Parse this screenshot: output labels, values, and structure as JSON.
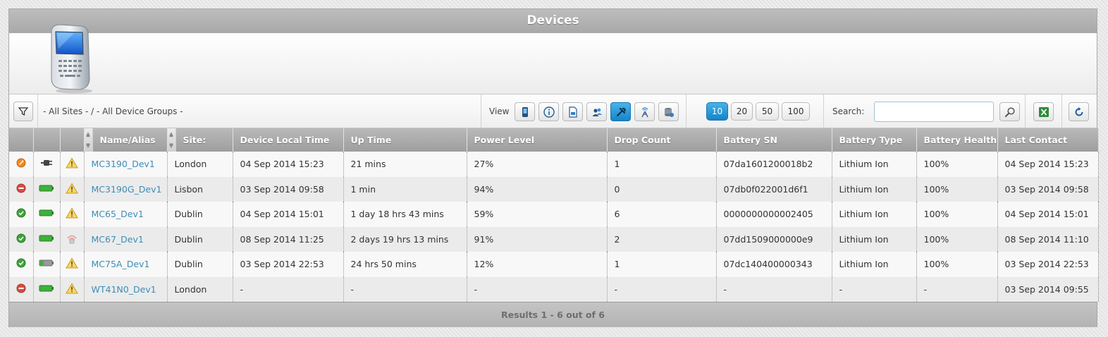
{
  "header": {
    "title": "Devices"
  },
  "toolbar": {
    "filter_path": "- All Sites - / - All Device Groups -",
    "view_label": "View",
    "view_icons": [
      "device-icon",
      "info-icon",
      "document-icon",
      "users-icon",
      "tools-icon",
      "antenna-icon",
      "database-icon"
    ],
    "active_view": "tools-icon",
    "page_sizes": [
      "10",
      "20",
      "50",
      "100"
    ],
    "active_page_size": "10",
    "search_label": "Search:",
    "search_value": "",
    "search_placeholder": ""
  },
  "table": {
    "columns": [
      "Name/Alias",
      "Site:",
      "Device Local Time",
      "Up Time",
      "Power Level",
      "Drop Count",
      "Battery SN",
      "Battery Type",
      "Battery Health",
      "Last Contact"
    ],
    "rows": [
      {
        "status": "warning-orange",
        "power": "plug",
        "alert": "warning",
        "cells": [
          "MC3190_Dev1",
          "London",
          "04 Sep 2014 15:23",
          "21 mins",
          "27%",
          "1",
          "07da1601200018b2",
          "Lithium Ion",
          "100%",
          "04 Sep 2014 15:23"
        ]
      },
      {
        "status": "stop-red",
        "power": "battery",
        "alert": "warning",
        "cells": [
          "MC3190G_Dev1",
          "Lisbon",
          "03 Sep 2014 09:58",
          "1 min",
          "94%",
          "0",
          "07db0f022001d6f1",
          "Lithium Ion",
          "100%",
          "03 Sep 2014 09:58"
        ]
      },
      {
        "status": "ok-green",
        "power": "battery",
        "alert": "warning",
        "cells": [
          "MC65_Dev1",
          "Dublin",
          "04 Sep 2014 15:01",
          "1 day 18 hrs 43 mins",
          "59%",
          "6",
          "0000000000002405",
          "Lithium Ion",
          "100%",
          "04 Sep 2014 15:01"
        ]
      },
      {
        "status": "ok-green",
        "power": "battery",
        "alert": "signal",
        "cells": [
          "MC67_Dev1",
          "Dublin",
          "08 Sep 2014 11:25",
          "2 days 19 hrs 13 mins",
          "91%",
          "2",
          "07dd1509000000e9",
          "Lithium Ion",
          "100%",
          "08 Sep 2014 11:10"
        ]
      },
      {
        "status": "ok-green",
        "power": "battery-low",
        "alert": "warning",
        "cells": [
          "MC75A_Dev1",
          "Dublin",
          "03 Sep 2014 22:53",
          "24 hrs 50 mins",
          "12%",
          "1",
          "07dc140400000343",
          "Lithium Ion",
          "100%",
          "03 Sep 2014 22:53"
        ]
      },
      {
        "status": "stop-red",
        "power": "battery",
        "alert": "warning",
        "cells": [
          "WT41N0_Dev1",
          "London",
          "-",
          "-",
          "-",
          "-",
          "-",
          "-",
          "-",
          "03 Sep 2014 09:55"
        ]
      }
    ]
  },
  "footer": {
    "results": "Results 1 - 6 out of 6"
  },
  "colors": {
    "accent": "#1e8fd2",
    "link": "#3d8db8",
    "ok": "#3fa33a",
    "stop": "#d94c42",
    "warn": "#e6a316"
  }
}
